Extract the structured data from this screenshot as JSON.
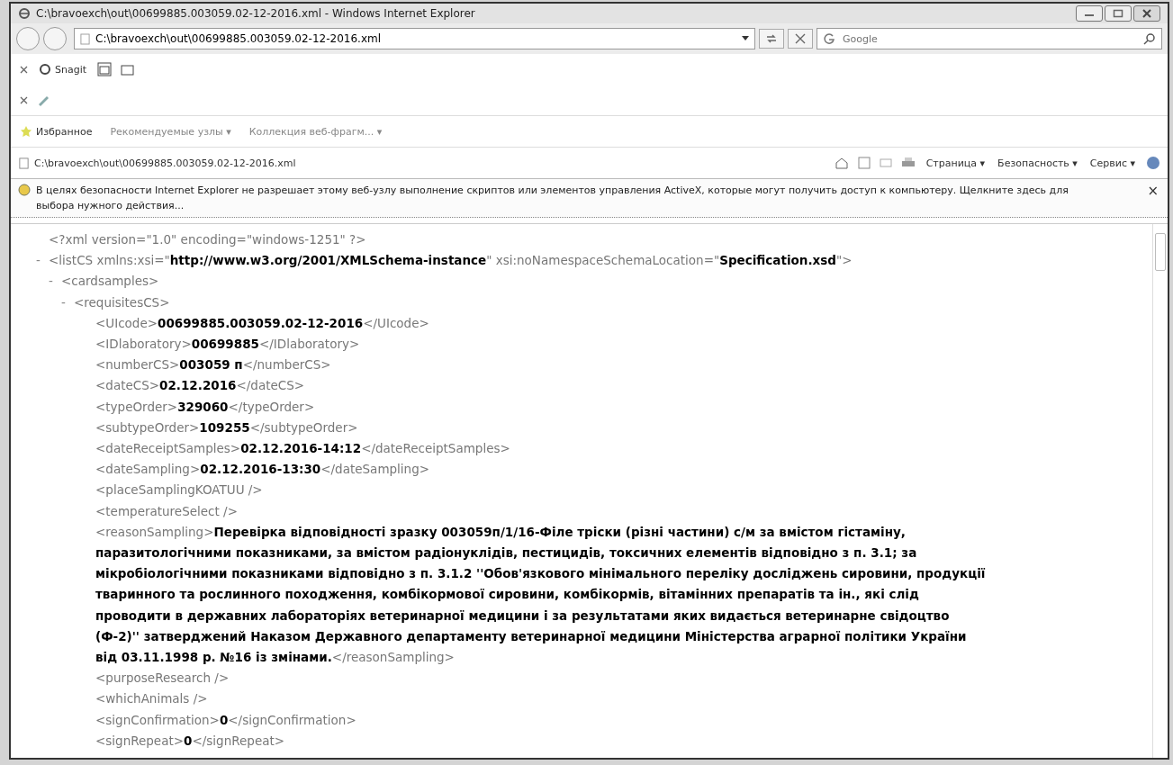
{
  "window": {
    "title": "C:\\bravoexch\\out\\00699885.003059.02-12-2016.xml - Windows Internet Explorer"
  },
  "address_bar": {
    "value": "C:\\bravoexch\\out\\00699885.003059.02-12-2016.xml"
  },
  "search": {
    "placeholder": "Google"
  },
  "toolbar": {
    "snagit": "Snagit"
  },
  "favorites_bar": {
    "label": "Избранное",
    "items": [
      "Рекомендуемые узлы ▾",
      "Коллекция веб-фрагм... ▾"
    ]
  },
  "tab": {
    "title": "C:\\bravoexch\\out\\00699885.003059.02-12-2016.xml"
  },
  "command_bar": [
    "Страница ▾",
    "Безопасность ▾",
    "Сервис ▾"
  ],
  "info_bar": {
    "text": "В целях безопасности Internet Explorer не разрешает этому веб-узлу выполнение скриптов или элементов управления ActiveX, которые могут получить доступ к компьютеру. Щелкните здесь для выбора нужного действия...",
    "close": "×"
  },
  "xml": [
    {
      "segments": [
        {
          "kind": "markup",
          "text": "<?xml version=\"1.0\" encoding=\"windows-1251\" ?>"
        }
      ]
    },
    {
      "toggle": "-",
      "segments": [
        {
          "kind": "markup",
          "text": "<listCS xmlns:xsi=\""
        },
        {
          "kind": "value",
          "text": "http://www.w3.org/2001/XMLSchema-instance"
        },
        {
          "kind": "markup",
          "text": "\" xsi:noNamespaceSchemaLocation=\""
        },
        {
          "kind": "value",
          "text": "Specification.xsd"
        },
        {
          "kind": "markup",
          "text": "\">"
        }
      ],
      "children": [
        {
          "toggle": "-",
          "segments": [
            {
              "kind": "markup",
              "text": "<cardsamples>"
            }
          ],
          "children": [
            {
              "toggle": "-",
              "segments": [
                {
                  "kind": "markup",
                  "text": "<requisitesCS>"
                }
              ],
              "children": [
                {
                  "segments": [
                    {
                      "kind": "markup",
                      "text": "<UIcode>"
                    },
                    {
                      "kind": "value",
                      "text": "00699885.003059.02-12-2016"
                    },
                    {
                      "kind": "markup",
                      "text": "</UIcode>"
                    }
                  ]
                },
                {
                  "segments": [
                    {
                      "kind": "markup",
                      "text": "<IDlaboratory>"
                    },
                    {
                      "kind": "value",
                      "text": "00699885"
                    },
                    {
                      "kind": "markup",
                      "text": "</IDlaboratory>"
                    }
                  ]
                },
                {
                  "segments": [
                    {
                      "kind": "markup",
                      "text": "<numberCS>"
                    },
                    {
                      "kind": "value",
                      "text": "003059 п"
                    },
                    {
                      "kind": "markup",
                      "text": "</numberCS>"
                    }
                  ]
                },
                {
                  "segments": [
                    {
                      "kind": "markup",
                      "text": "<dateCS>"
                    },
                    {
                      "kind": "value",
                      "text": "02.12.2016"
                    },
                    {
                      "kind": "markup",
                      "text": "</dateCS>"
                    }
                  ]
                },
                {
                  "segments": [
                    {
                      "kind": "markup",
                      "text": "<typeOrder>"
                    },
                    {
                      "kind": "value",
                      "text": "329060"
                    },
                    {
                      "kind": "markup",
                      "text": "</typeOrder>"
                    }
                  ]
                },
                {
                  "segments": [
                    {
                      "kind": "markup",
                      "text": "<subtypeOrder>"
                    },
                    {
                      "kind": "value",
                      "text": "109255"
                    },
                    {
                      "kind": "markup",
                      "text": "</subtypeOrder>"
                    }
                  ]
                },
                {
                  "segments": [
                    {
                      "kind": "markup",
                      "text": "<dateReceiptSamples>"
                    },
                    {
                      "kind": "value",
                      "text": "02.12.2016-14:12"
                    },
                    {
                      "kind": "markup",
                      "text": "</dateReceiptSamples>"
                    }
                  ]
                },
                {
                  "segments": [
                    {
                      "kind": "markup",
                      "text": "<dateSampling>"
                    },
                    {
                      "kind": "value",
                      "text": "02.12.2016-13:30"
                    },
                    {
                      "kind": "markup",
                      "text": "</dateSampling>"
                    }
                  ]
                },
                {
                  "segments": [
                    {
                      "kind": "markup",
                      "text": "<placeSamplingKOATUU />"
                    }
                  ]
                },
                {
                  "segments": [
                    {
                      "kind": "markup",
                      "text": "<temperatureSelect />"
                    }
                  ]
                },
                {
                  "segments": [
                    {
                      "kind": "markup",
                      "text": "<reasonSampling>"
                    },
                    {
                      "kind": "value",
                      "text": "Перевірка відповідності зразку 003059п/1/16-Філе тріски (різні частини) с/м за вмістом гістаміну, паразитологічними показниками, за вмістом радіонуклідів, пестицидів, токсичних елементів відповідно з п. 3.1; за мікробіологічними показниками відповідно з п. 3.1.2 ''Обов'язкового мінімального переліку досліджень сировини, продукції тваринного та рослинного походження, комбікормової сировини, комбікормів, вітамінних препаратів та ін., які слід проводити в державних лабораторіях ветеринарної медицини і за результатами яких видається ветеринарне свідоцтво (Ф-2)'' затверджений Наказом Державного департаменту ветеринарної медицини Міністерства аграрної політики України від 03.11.1998 р. №16 із змінами."
                    },
                    {
                      "kind": "markup",
                      "text": "</reasonSampling>"
                    }
                  ]
                },
                {
                  "segments": [
                    {
                      "kind": "markup",
                      "text": "<purposeResearch />"
                    }
                  ]
                },
                {
                  "segments": [
                    {
                      "kind": "markup",
                      "text": "<whichAnimals />"
                    }
                  ]
                },
                {
                  "segments": [
                    {
                      "kind": "markup",
                      "text": "<signConfirmation>"
                    },
                    {
                      "kind": "value",
                      "text": "0"
                    },
                    {
                      "kind": "markup",
                      "text": "</signConfirmation>"
                    }
                  ]
                },
                {
                  "segments": [
                    {
                      "kind": "markup",
                      "text": "<signRepeat>"
                    },
                    {
                      "kind": "value",
                      "text": "0"
                    },
                    {
                      "kind": "markup",
                      "text": "</signRepeat>"
                    }
                  ]
                }
              ]
            }
          ]
        }
      ]
    }
  ]
}
